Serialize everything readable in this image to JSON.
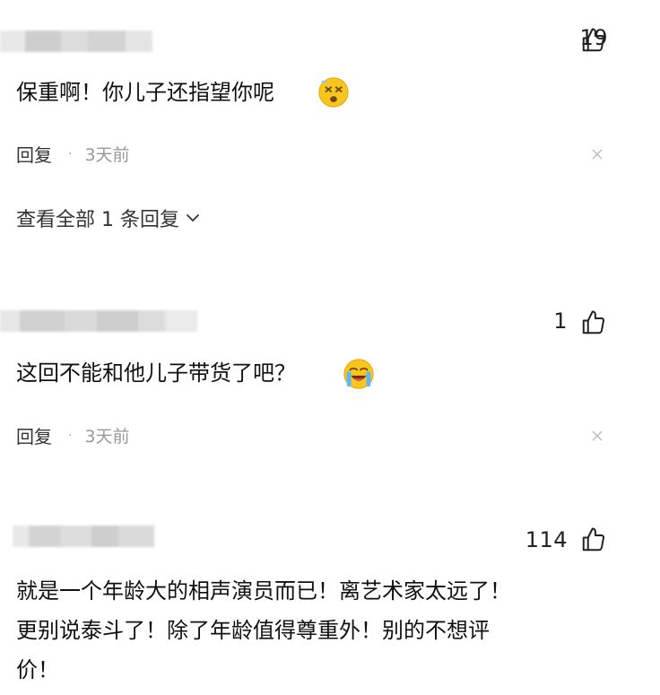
{
  "comments": [
    {
      "likes": "19",
      "text": "保重啊！你儿子还指望你呢",
      "emoji_icon": "dizzy-face-emoji",
      "reply_label": "回复",
      "separator": "·",
      "time": "3天前",
      "view_all": "查看全部 1 条回复"
    },
    {
      "likes": "1",
      "text": "这回不能和他儿子带货了吧？",
      "emoji_icon": "loudly-crying-emoji",
      "reply_label": "回复",
      "separator": "·",
      "time": "3天前"
    },
    {
      "likes": "114",
      "lines": [
        "就是一个年龄大的相声演员而已！离艺术家太远了！",
        "更别说泰斗了！除了年龄值得尊重外！别的不想评",
        "价！"
      ]
    }
  ],
  "icons": {
    "like": "thumbs-up-icon",
    "close": "close-icon",
    "expand": "chevron-down-icon"
  }
}
